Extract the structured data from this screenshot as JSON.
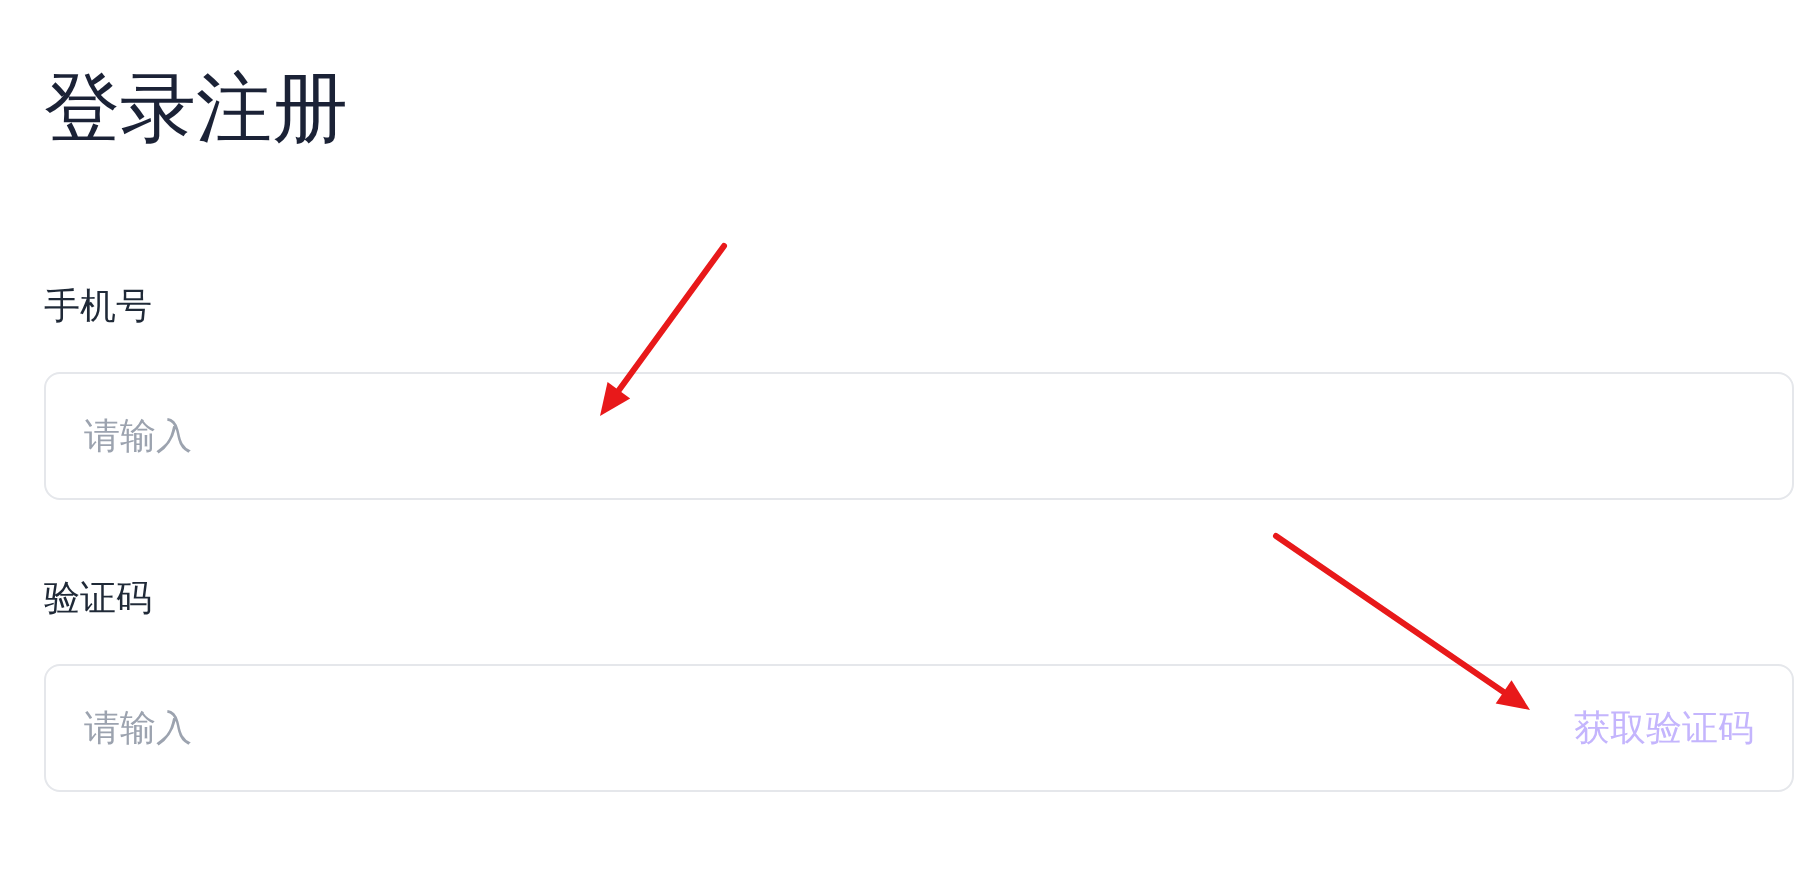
{
  "title": "登录注册",
  "fields": [
    {
      "label": "手机号",
      "placeholder": "请输入"
    },
    {
      "label": "验证码",
      "placeholder": "请输入",
      "action": "获取验证码"
    }
  ],
  "annotations": [
    {
      "kind": "arrow"
    },
    {
      "kind": "arrow"
    }
  ]
}
